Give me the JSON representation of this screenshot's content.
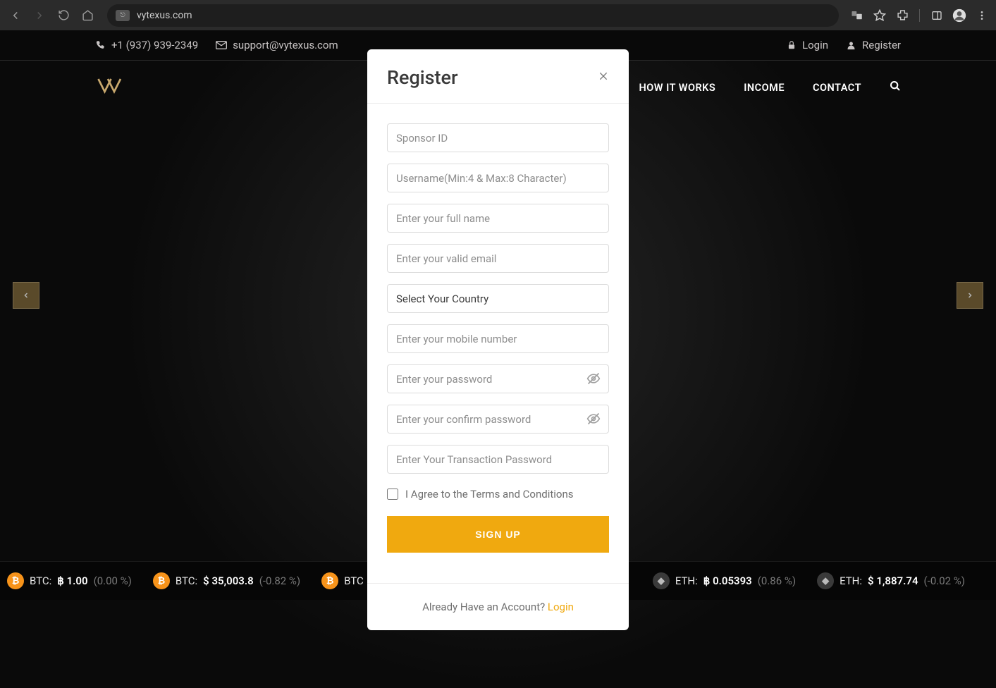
{
  "browser": {
    "url": "vytexus.com"
  },
  "topbar": {
    "phone": "+1 (937) 939-2349",
    "email": "support@vytexus.com",
    "login": "Login",
    "register": "Register"
  },
  "nav": {
    "howitworks": "HOW IT WORKS",
    "income": "INCOME",
    "contact": "CONTACT"
  },
  "ticker": [
    {
      "coin": "btc",
      "label": "BTC:",
      "symbol": "฿",
      "price": "1.00",
      "change": "(0.00 %)"
    },
    {
      "coin": "btc",
      "label": "BTC:",
      "symbol": "$",
      "price": "35,003.8",
      "change": "(-0.82 %)"
    },
    {
      "coin": "btc",
      "label": "BTC",
      "symbol": "",
      "price": "",
      "change": ""
    },
    {
      "coin": "eth",
      "label": "ETH:",
      "symbol": "฿",
      "price": "0.05393",
      "change": "(0.86 %)"
    },
    {
      "coin": "eth",
      "label": "ETH:",
      "symbol": "$",
      "price": "1,887.74",
      "change": "(-0.02 %)"
    }
  ],
  "modal": {
    "title": "Register",
    "placeholders": {
      "sponsor": "Sponsor ID",
      "username": "Username(Min:4 & Max:8 Character)",
      "fullname": "Enter your full name",
      "email": "Enter your valid email",
      "country": "Select Your Country",
      "mobile": "Enter your mobile number",
      "password": "Enter your password",
      "confirm": "Enter your confirm password",
      "txnpass": "Enter Your Transaction Password"
    },
    "terms": "I Agree to the Terms and Conditions",
    "signup": "SIGN UP",
    "alreadyText": "Already Have an Account? ",
    "loginLink": "Login"
  }
}
